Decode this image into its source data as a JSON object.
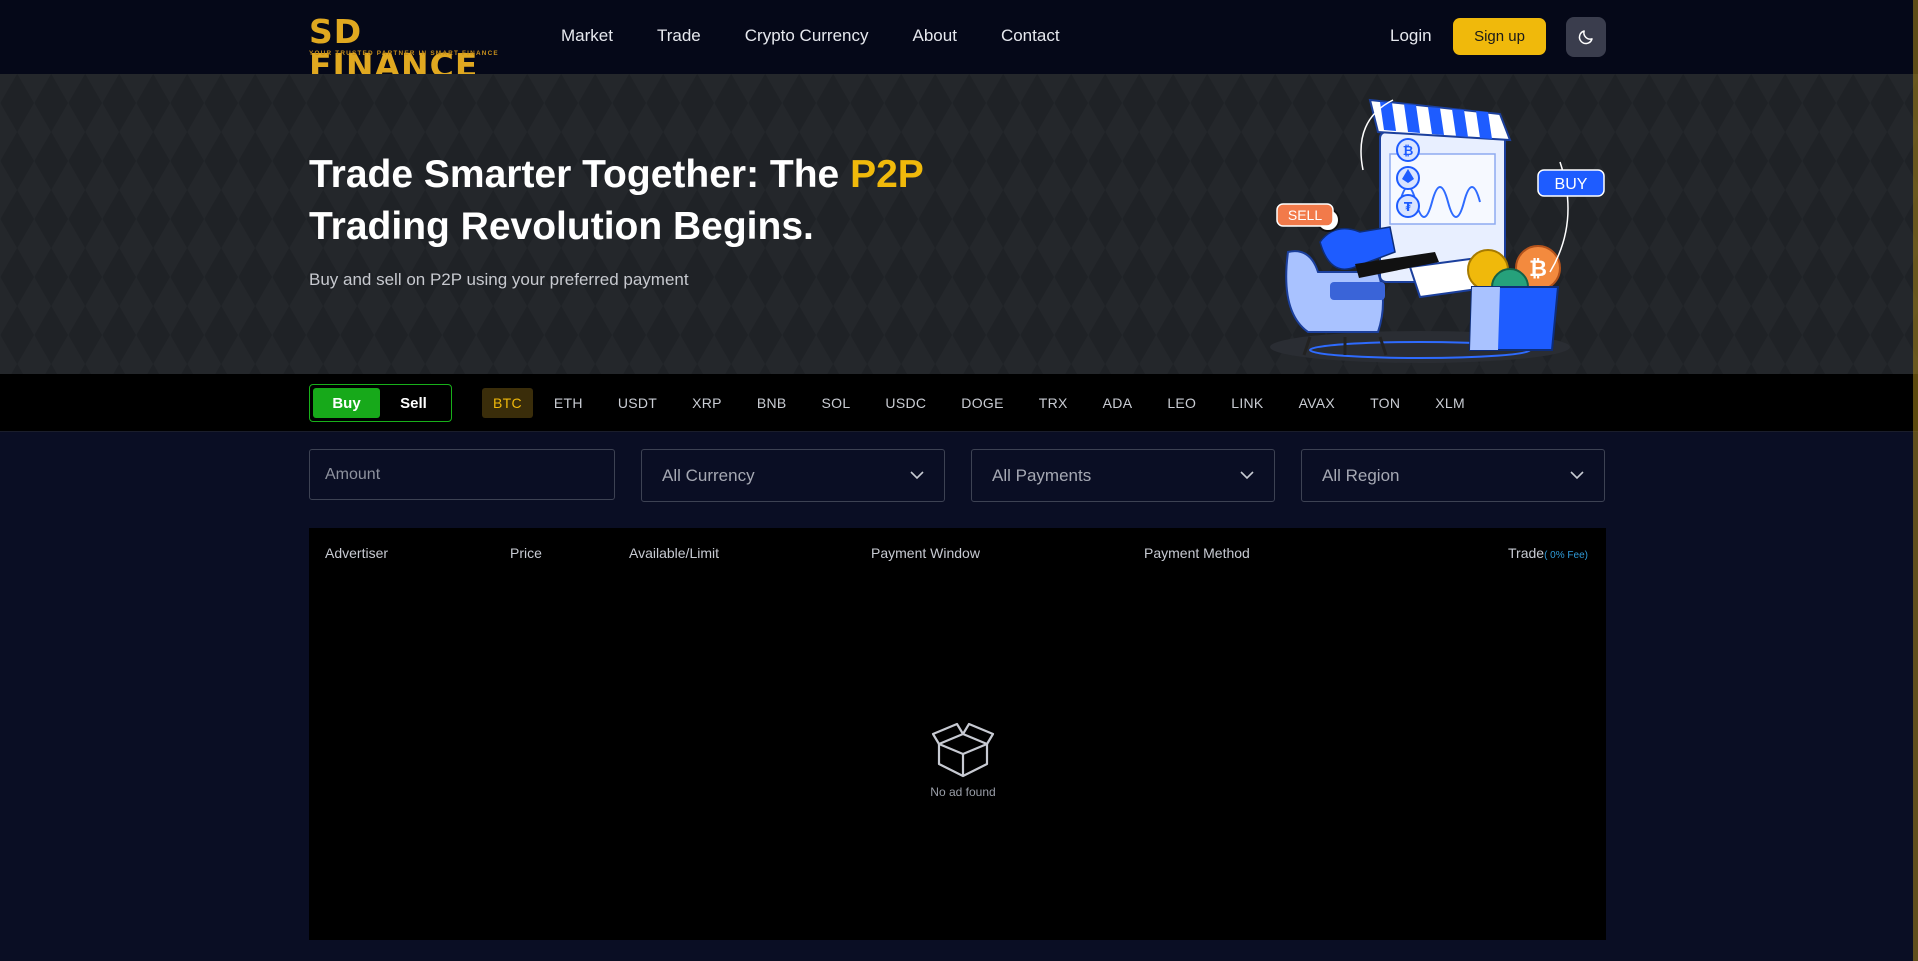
{
  "logo": {
    "brand": "SD FINANCE",
    "tagline": "YOUR TRUSTED PARTNER IN SMART FINANCE"
  },
  "nav": {
    "links": [
      "Market",
      "Trade",
      "Crypto Currency",
      "About",
      "Contact"
    ],
    "login": "Login",
    "signup": "Sign up",
    "theme_icon": "moon-icon"
  },
  "hero": {
    "title_part1": "Trade Smarter Together: The ",
    "title_highlight": "P2P",
    "title_part2": "Trading Revolution Begins.",
    "subtitle": "Buy and sell on P2P using your preferred payment",
    "badge_sell": "SELL",
    "badge_buy": "BUY"
  },
  "trade_toggle": {
    "buy": "Buy",
    "sell": "Sell",
    "selected": "Buy"
  },
  "tokens": {
    "items": [
      "BTC",
      "ETH",
      "USDT",
      "XRP",
      "BNB",
      "SOL",
      "USDC",
      "DOGE",
      "TRX",
      "ADA",
      "LEO",
      "LINK",
      "AVAX",
      "TON",
      "XLM"
    ],
    "selected": "BTC"
  },
  "filters": {
    "amount_placeholder": "Amount",
    "currency": "All Currency",
    "payments": "All Payments",
    "region": "All Region"
  },
  "table": {
    "headers": {
      "advertiser": "Advertiser",
      "price": "Price",
      "available": "Available/Limit",
      "payment_window": "Payment Window",
      "payment_method": "Payment Method",
      "trade": "Trade",
      "fee": "( 0% Fee)"
    },
    "empty_text": "No ad found"
  },
  "colors": {
    "accent": "#f0b90b",
    "buy_green": "#17a91a",
    "fee_blue": "#2f9bd9"
  }
}
